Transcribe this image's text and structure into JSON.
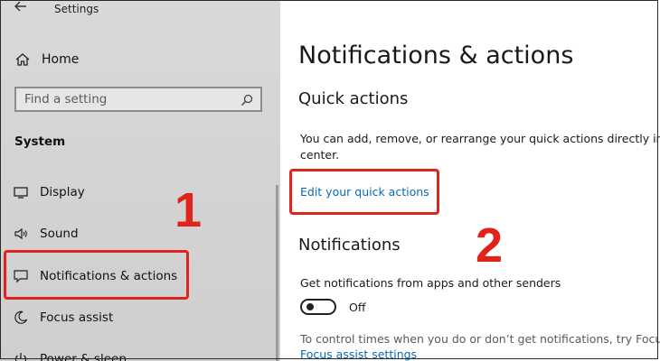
{
  "window": {
    "title": "Settings"
  },
  "sidebar": {
    "home_label": "Home",
    "search": {
      "placeholder": "Find a setting"
    },
    "section_title": "System",
    "items": [
      {
        "label": "Display",
        "icon": "display-icon"
      },
      {
        "label": "Sound",
        "icon": "speaker-icon"
      },
      {
        "label": "Notifications & actions",
        "icon": "message-icon",
        "selected": true
      },
      {
        "label": "Focus assist",
        "icon": "moon-icon"
      },
      {
        "label": "Power & sleep",
        "icon": "power-icon"
      }
    ]
  },
  "main": {
    "page_title": "Notifications & actions",
    "quick_actions": {
      "heading": "Quick actions",
      "description_line1": "You can add, remove, or rearrange your quick actions directly in ac",
      "description_line2": "center.",
      "edit_link": "Edit your quick actions"
    },
    "notifications": {
      "heading": "Notifications",
      "get_notifications_label": "Get notifications from apps and other senders",
      "toggle_state": "Off",
      "focus_text": "To control times when you do or don’t get notifications, try Focus a",
      "focus_link": "Focus assist settings"
    }
  },
  "annotations": {
    "marker_1": "1",
    "marker_2": "2",
    "color": "#e2231a"
  },
  "colors": {
    "link": "#0a6ab8",
    "sidebar_bg": "#d6d6d6"
  }
}
